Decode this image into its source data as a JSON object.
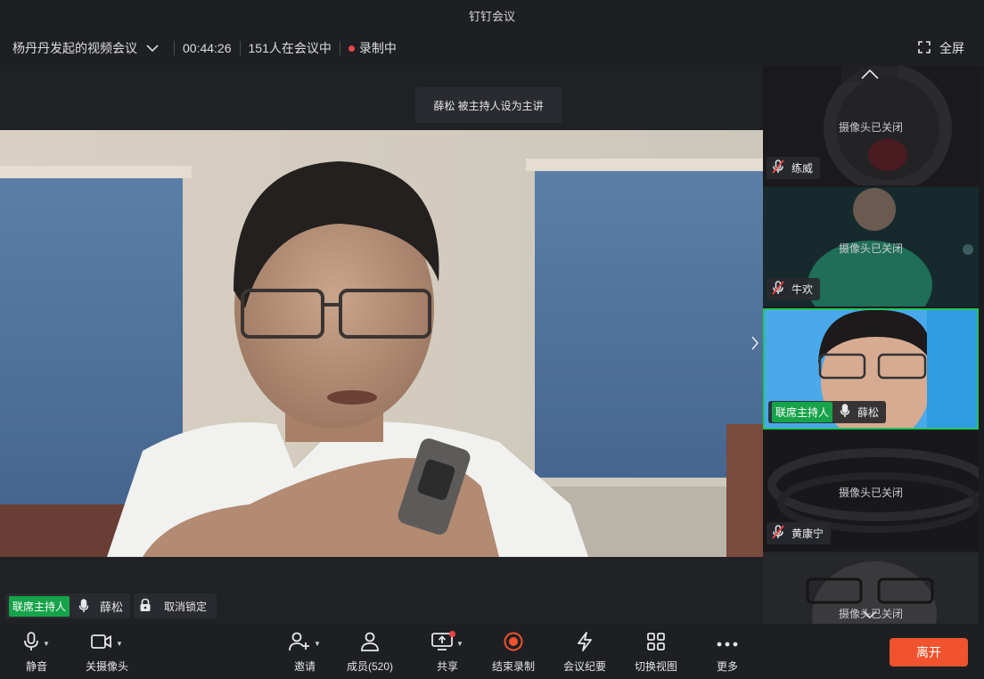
{
  "window": {
    "title": "钉钉会议"
  },
  "meeting": {
    "name": "杨丹丹发起的视频会议",
    "duration": "00:44:26",
    "attendees": "151人在会议中",
    "recording": "录制中",
    "fullscreen_label": "全屏"
  },
  "stage": {
    "toast": "薛松 被主持人设为主讲",
    "speaker": {
      "badge": "联席主持人",
      "name": "薛松"
    },
    "unlock_label": "取消锁定"
  },
  "participants": [
    {
      "name": "练威",
      "camera_status": "摄像头已关闭",
      "muted": true
    },
    {
      "name": "牛欢",
      "camera_status": "摄像头已关闭",
      "muted": true
    },
    {
      "name": "薛松",
      "badge": "联席主持人",
      "muted": false,
      "active": true
    },
    {
      "name": "黄康宁",
      "camera_status": "摄像头已关闭",
      "muted": true
    },
    {
      "name": "",
      "camera_status": "摄像头已关闭",
      "muted": true
    }
  ],
  "toolbar": {
    "mute": "静音",
    "camera_off": "关摄像头",
    "invite": "邀请",
    "members": "成员(520)",
    "share": "共享",
    "end_recording": "结束录制",
    "minutes": "会议纪要",
    "switch_view": "切换视图",
    "more": "更多",
    "leave": "离开"
  },
  "colors": {
    "accent_green": "#22c55e",
    "host_badge": "#16a34a",
    "leave_button": "#f0532d",
    "record_red": "#e5484d"
  }
}
